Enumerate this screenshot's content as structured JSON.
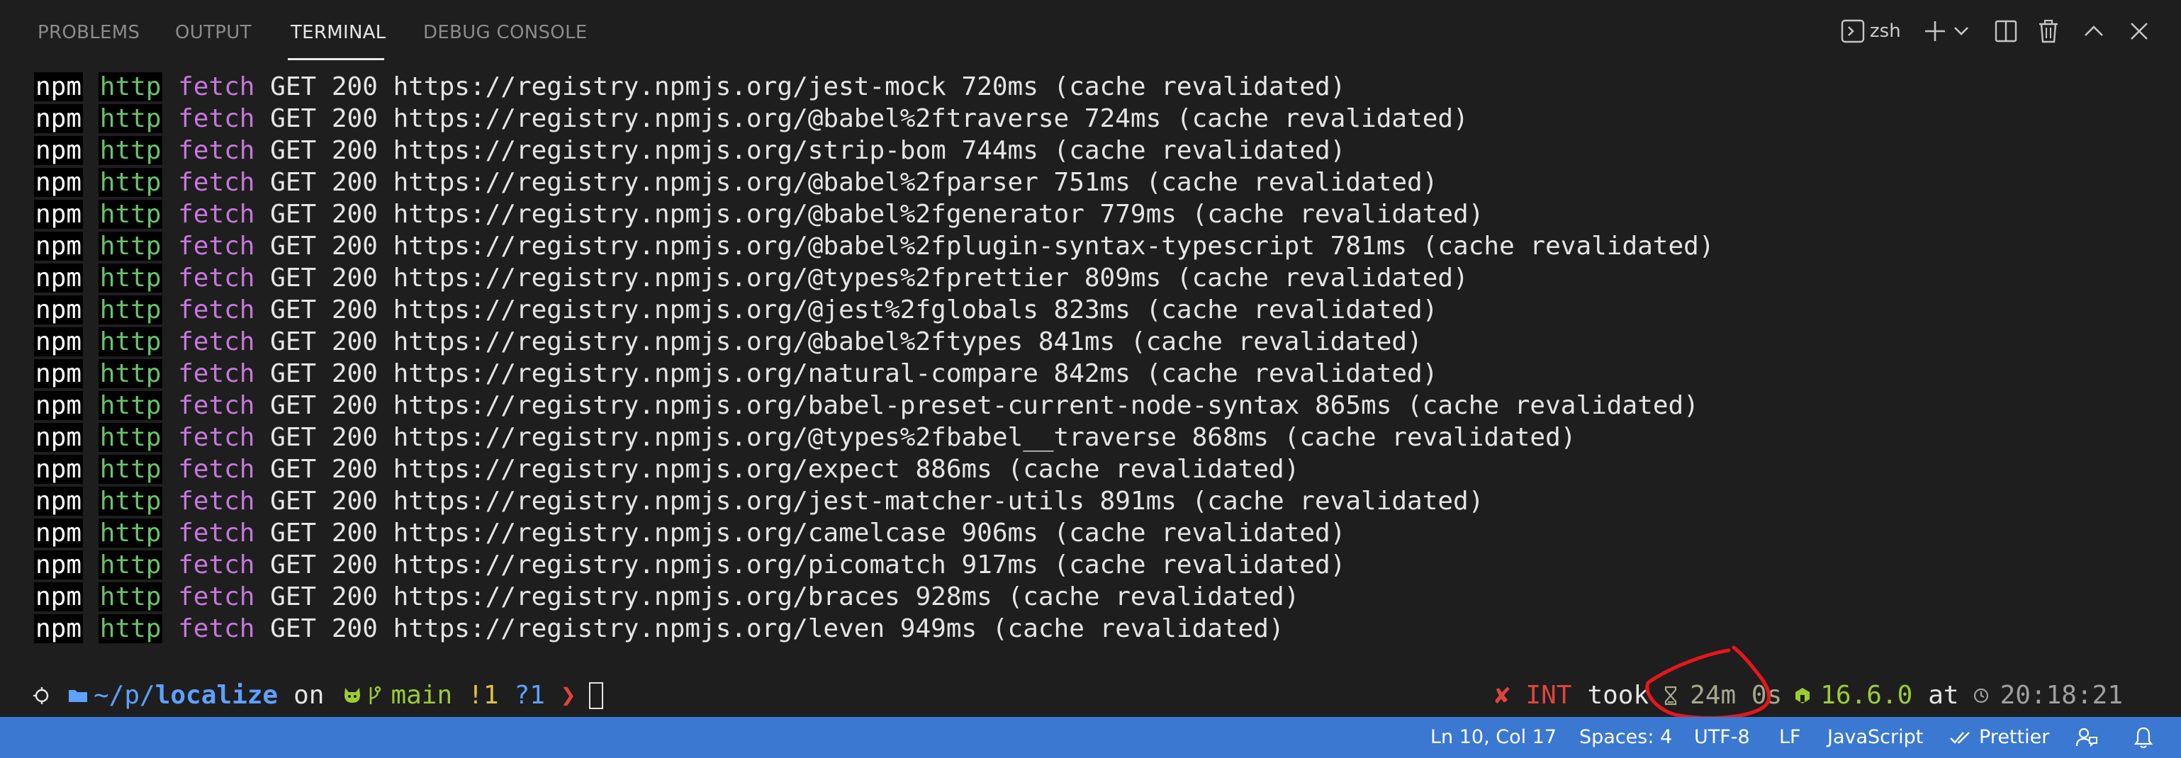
{
  "panel": {
    "tabs": [
      {
        "label": "PROBLEMS",
        "active": false
      },
      {
        "label": "OUTPUT",
        "active": false
      },
      {
        "label": "TERMINAL",
        "active": true
      },
      {
        "label": "DEBUG CONSOLE",
        "active": false
      }
    ],
    "shell_label": "zsh",
    "tools": [
      "terminal-icon",
      "plus-icon",
      "chevron-down-icon",
      "split-icon",
      "trash-icon",
      "chevron-up-icon",
      "close-icon"
    ]
  },
  "terminal": {
    "lines": [
      {
        "npm": "npm",
        "http": "http",
        "fetch": "fetch",
        "rest": "GET 200 https://registry.npmjs.org/jest-mock 720ms (cache revalidated)"
      },
      {
        "npm": "npm",
        "http": "http",
        "fetch": "fetch",
        "rest": "GET 200 https://registry.npmjs.org/@babel%2ftraverse 724ms (cache revalidated)"
      },
      {
        "npm": "npm",
        "http": "http",
        "fetch": "fetch",
        "rest": "GET 200 https://registry.npmjs.org/strip-bom 744ms (cache revalidated)"
      },
      {
        "npm": "npm",
        "http": "http",
        "fetch": "fetch",
        "rest": "GET 200 https://registry.npmjs.org/@babel%2fparser 751ms (cache revalidated)"
      },
      {
        "npm": "npm",
        "http": "http",
        "fetch": "fetch",
        "rest": "GET 200 https://registry.npmjs.org/@babel%2fgenerator 779ms (cache revalidated)"
      },
      {
        "npm": "npm",
        "http": "http",
        "fetch": "fetch",
        "rest": "GET 200 https://registry.npmjs.org/@babel%2fplugin-syntax-typescript 781ms (cache revalidated)"
      },
      {
        "npm": "npm",
        "http": "http",
        "fetch": "fetch",
        "rest": "GET 200 https://registry.npmjs.org/@types%2fprettier 809ms (cache revalidated)"
      },
      {
        "npm": "npm",
        "http": "http",
        "fetch": "fetch",
        "rest": "GET 200 https://registry.npmjs.org/@jest%2fglobals 823ms (cache revalidated)"
      },
      {
        "npm": "npm",
        "http": "http",
        "fetch": "fetch",
        "rest": "GET 200 https://registry.npmjs.org/@babel%2ftypes 841ms (cache revalidated)"
      },
      {
        "npm": "npm",
        "http": "http",
        "fetch": "fetch",
        "rest": "GET 200 https://registry.npmjs.org/natural-compare 842ms (cache revalidated)"
      },
      {
        "npm": "npm",
        "http": "http",
        "fetch": "fetch",
        "rest": "GET 200 https://registry.npmjs.org/babel-preset-current-node-syntax 865ms (cache revalidated)"
      },
      {
        "npm": "npm",
        "http": "http",
        "fetch": "fetch",
        "rest": "GET 200 https://registry.npmjs.org/@types%2fbabel__traverse 868ms (cache revalidated)"
      },
      {
        "npm": "npm",
        "http": "http",
        "fetch": "fetch",
        "rest": "GET 200 https://registry.npmjs.org/expect 886ms (cache revalidated)"
      },
      {
        "npm": "npm",
        "http": "http",
        "fetch": "fetch",
        "rest": "GET 200 https://registry.npmjs.org/jest-matcher-utils 891ms (cache revalidated)"
      },
      {
        "npm": "npm",
        "http": "http",
        "fetch": "fetch",
        "rest": "GET 200 https://registry.npmjs.org/camelcase 906ms (cache revalidated)"
      },
      {
        "npm": "npm",
        "http": "http",
        "fetch": "fetch",
        "rest": "GET 200 https://registry.npmjs.org/picomatch 917ms (cache revalidated)"
      },
      {
        "npm": "npm",
        "http": "http",
        "fetch": "fetch",
        "rest": "GET 200 https://registry.npmjs.org/braces 928ms (cache revalidated)"
      },
      {
        "npm": "npm",
        "http": "http",
        "fetch": "fetch",
        "rest": "GET 200 https://registry.npmjs.org/leven 949ms (cache revalidated)"
      }
    ],
    "prompt": {
      "path_prefix": "~/p/",
      "path_dir": "localize",
      "on": "on",
      "branch": "main",
      "modified": "!1",
      "untracked": "?1",
      "arrow": "❯"
    },
    "right_prompt": {
      "status_mark": "✘",
      "status": "INT",
      "took": "took",
      "duration": "24m 0s",
      "node_version": "16.6.0",
      "at": "at",
      "time": "20:18:21"
    }
  },
  "statusbar": {
    "position": "Ln 10, Col 17",
    "spaces": "Spaces: 4",
    "encoding": "UTF-8",
    "eol": "LF",
    "language": "JavaScript",
    "formatter": "Prettier"
  },
  "colors": {
    "background": "#1e1e1e",
    "statusbar": "#3a78d1",
    "http_green": "#6ac26a",
    "fetch_purple": "#c678dd",
    "path_blue": "#5ea1ff",
    "branch_green": "#9ccc35",
    "prompt_red": "#e0443e",
    "annotation_red": "#e8161b"
  }
}
